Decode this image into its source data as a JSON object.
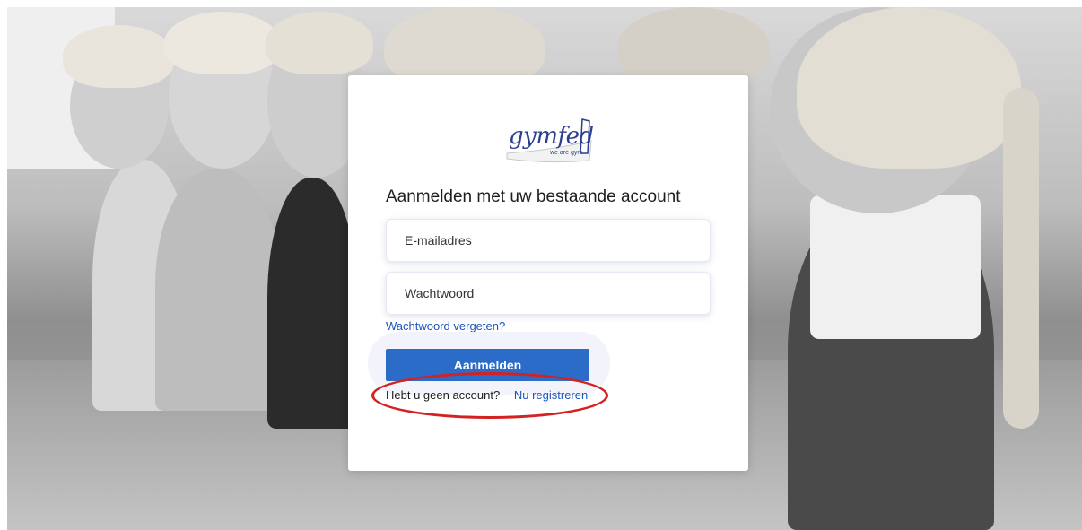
{
  "logo": {
    "name": "gymfed",
    "tagline": "we are gym"
  },
  "form": {
    "title": "Aanmelden met uw bestaande account",
    "email_placeholder": "E-mailadres",
    "password_placeholder": "Wachtwoord",
    "forgot_password": "Wachtwoord vergeten?",
    "submit_label": "Aanmelden",
    "no_account_text": "Hebt u geen account?",
    "register_link": "Nu registreren"
  },
  "colors": {
    "primary_button": "#2a6cc7",
    "link": "#1a56b8",
    "brand": "#2c3f8f",
    "annotation": "#d42222"
  }
}
